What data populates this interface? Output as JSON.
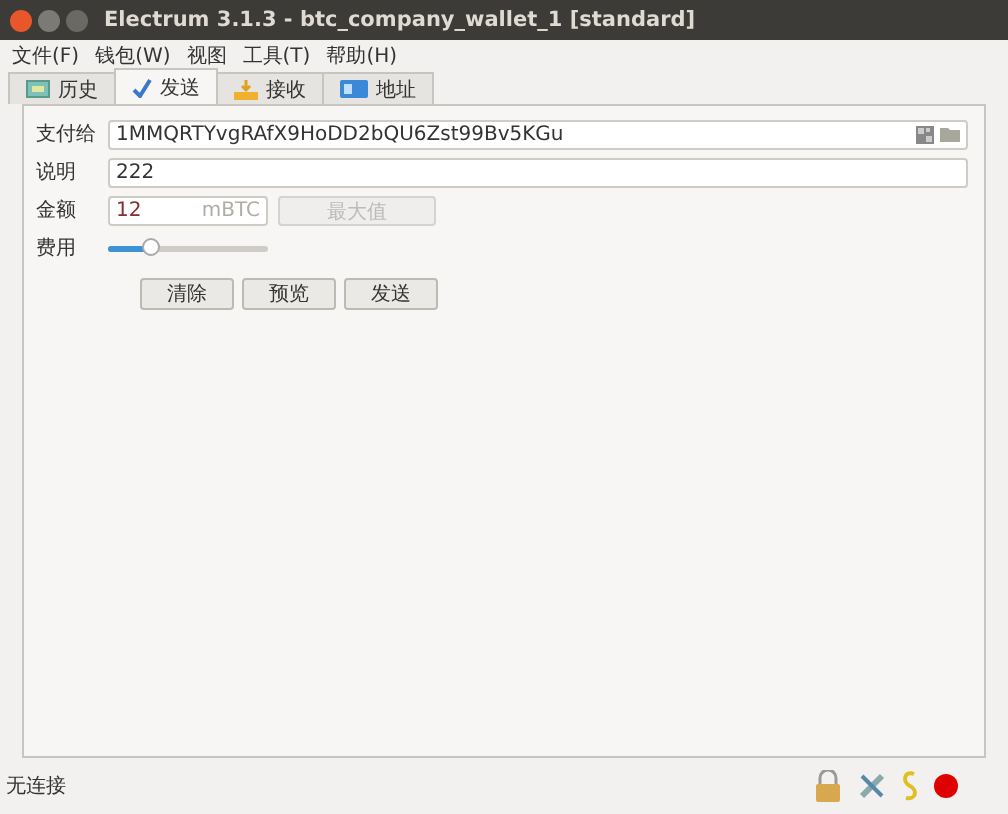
{
  "window": {
    "title": "Electrum 3.1.3  -  btc_company_wallet_1  [standard]"
  },
  "menu": [
    "文件(F)",
    "钱包(W)",
    "视图",
    "工具(T)",
    "帮助(H)"
  ],
  "tabs": [
    {
      "label": "历史",
      "selected": false
    },
    {
      "label": "发送",
      "selected": true
    },
    {
      "label": "接收",
      "selected": false
    },
    {
      "label": "地址",
      "selected": false
    }
  ],
  "send": {
    "pay_to": {
      "label": "支付给",
      "value": "1MMQRTYvgRAfX9HoDD2bQU6Zst99Bv5KGu"
    },
    "description": {
      "label": "说明",
      "value": "222"
    },
    "amount": {
      "label": "金额",
      "value": "12",
      "unit": "mBTC",
      "max_button": "最大值",
      "max_disabled": true
    },
    "fee": {
      "label": "费用",
      "level": 0.28
    },
    "buttons": [
      "清除",
      "预览",
      "发送"
    ]
  },
  "status_bar": {
    "text": "无连接",
    "connected": false
  }
}
